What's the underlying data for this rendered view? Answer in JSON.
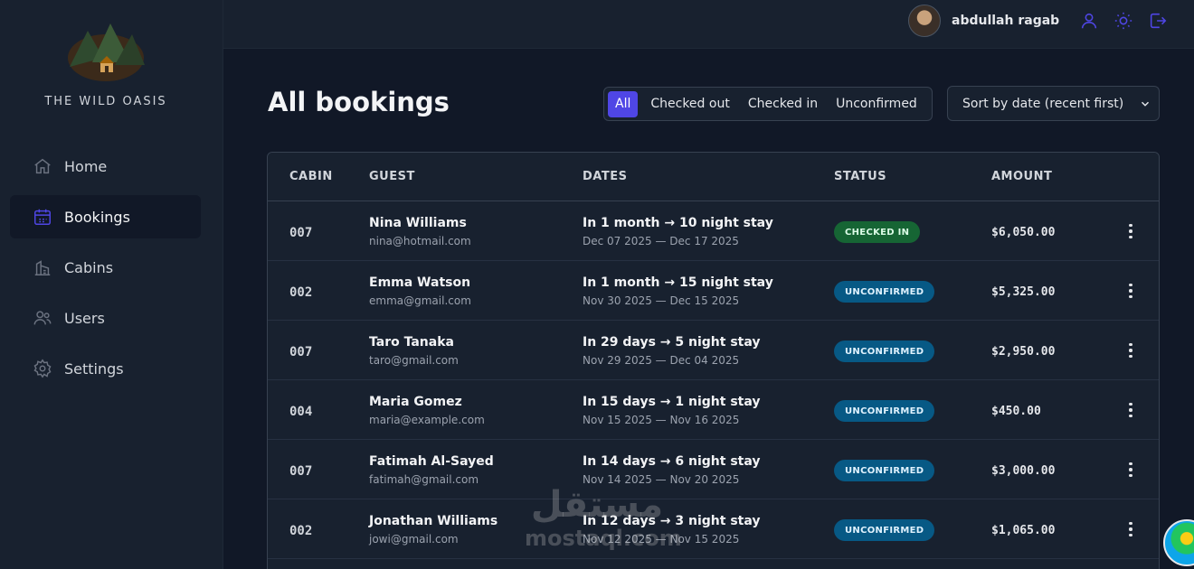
{
  "brand": {
    "name": "THE WILD OASIS"
  },
  "nav": {
    "items": [
      {
        "label": "Home",
        "icon": "home-icon",
        "active": false
      },
      {
        "label": "Bookings",
        "icon": "calendar-icon",
        "active": true
      },
      {
        "label": "Cabins",
        "icon": "cabins-icon",
        "active": false
      },
      {
        "label": "Users",
        "icon": "users-icon",
        "active": false
      },
      {
        "label": "Settings",
        "icon": "settings-icon",
        "active": false
      }
    ]
  },
  "header": {
    "username": "abdullah ragab",
    "icons": [
      "user-icon",
      "sun-icon",
      "logout-icon"
    ],
    "accent": "#4f46e5"
  },
  "page": {
    "title": "All bookings",
    "filters": [
      "All",
      "Checked out",
      "Checked in",
      "Unconfirmed"
    ],
    "active_filter": "All",
    "sort": "Sort by date (recent first)"
  },
  "table": {
    "columns": [
      "CABIN",
      "GUEST",
      "DATES",
      "STATUS",
      "AMOUNT"
    ],
    "rows": [
      {
        "cabin": "007",
        "guest": "Nina Williams",
        "email": "nina@hotmail.com",
        "stay": "In 1 month → 10 night stay",
        "range": "Dec 07 2025 — Dec 17 2025",
        "status": "CHECKED IN",
        "amount": "$6,050.00"
      },
      {
        "cabin": "002",
        "guest": "Emma Watson",
        "email": "emma@gmail.com",
        "stay": "In 1 month → 15 night stay",
        "range": "Nov 30 2025 — Dec 15 2025",
        "status": "UNCONFIRMED",
        "amount": "$5,325.00"
      },
      {
        "cabin": "007",
        "guest": "Taro Tanaka",
        "email": "taro@gmail.com",
        "stay": "In 29 days → 5 night stay",
        "range": "Nov 29 2025 — Dec 04 2025",
        "status": "UNCONFIRMED",
        "amount": "$2,950.00"
      },
      {
        "cabin": "004",
        "guest": "Maria Gomez",
        "email": "maria@example.com",
        "stay": "In 15 days → 1 night stay",
        "range": "Nov 15 2025 — Nov 16 2025",
        "status": "UNCONFIRMED",
        "amount": "$450.00"
      },
      {
        "cabin": "007",
        "guest": "Fatimah Al-Sayed",
        "email": "fatimah@gmail.com",
        "stay": "In 14 days → 6 night stay",
        "range": "Nov 14 2025 — Nov 20 2025",
        "status": "UNCONFIRMED",
        "amount": "$3,000.00"
      },
      {
        "cabin": "002",
        "guest": "Jonathan Williams",
        "email": "jowi@gmail.com",
        "stay": "In 12 days → 3 night stay",
        "range": "Nov 12 2025 — Nov 15 2025",
        "status": "UNCONFIRMED",
        "amount": "$1,065.00"
      }
    ]
  },
  "watermark": {
    "arabic": "مستقل",
    "latin": "mostaql.com"
  },
  "colors": {
    "checked_in": "#166534",
    "unconfirmed": "#075985",
    "background": "#111827",
    "surface": "#18212f"
  }
}
